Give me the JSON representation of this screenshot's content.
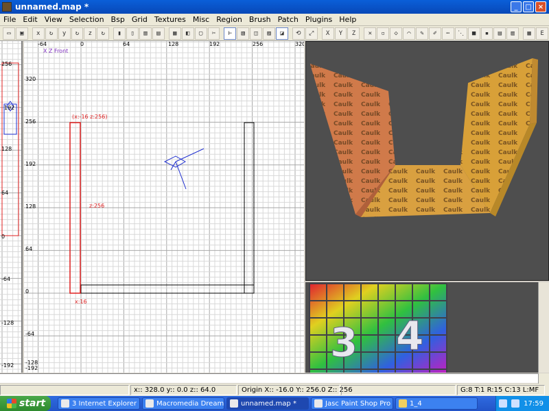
{
  "window": {
    "title": "unnamed.map *"
  },
  "menu": [
    "File",
    "Edit",
    "View",
    "Selection",
    "Bsp",
    "Grid",
    "Textures",
    "Misc",
    "Region",
    "Brush",
    "Patch",
    "Plugins",
    "Help"
  ],
  "viewport2d": {
    "label": "X Z Front",
    "x_ticks": [
      "-64",
      "0",
      "64",
      "128",
      "192",
      "256",
      "320"
    ],
    "y_ticks": [
      "320",
      "256",
      "192",
      "128",
      "64",
      "0",
      "-64",
      "-128",
      "-192"
    ],
    "brush_top_label": "(x:-16  z:256)",
    "brush_mid_label": "z:256",
    "brush_bottom_label": "x:16"
  },
  "sideview": {
    "ticks": [
      "256",
      "192",
      "128",
      "64",
      "0",
      "-64",
      "-128",
      "-192"
    ]
  },
  "texture_browser": {
    "numbers": [
      "3",
      "4"
    ]
  },
  "status": {
    "coords": "x:: 328.0  y:: 0.0  z:: 64.0",
    "origin": "Origin X:: -16.0  Y:: 256.0  Z:: 256",
    "grid": "G:8 T:1 R:15 C:13 L:MF"
  },
  "taskbar": {
    "start_label": "start",
    "tasks": [
      "3 Internet Explorer",
      "Macromedia Dreamw...",
      "unnamed.map *",
      "Jasc Paint Shop Pro - ...",
      "1_4"
    ],
    "time": "17:59"
  },
  "colors": {
    "selection": "#e02020",
    "brush": "#000000",
    "entity": "#2030d0",
    "grid_minor": "#d8d8d8",
    "grid_major": "#a8a8a8"
  }
}
